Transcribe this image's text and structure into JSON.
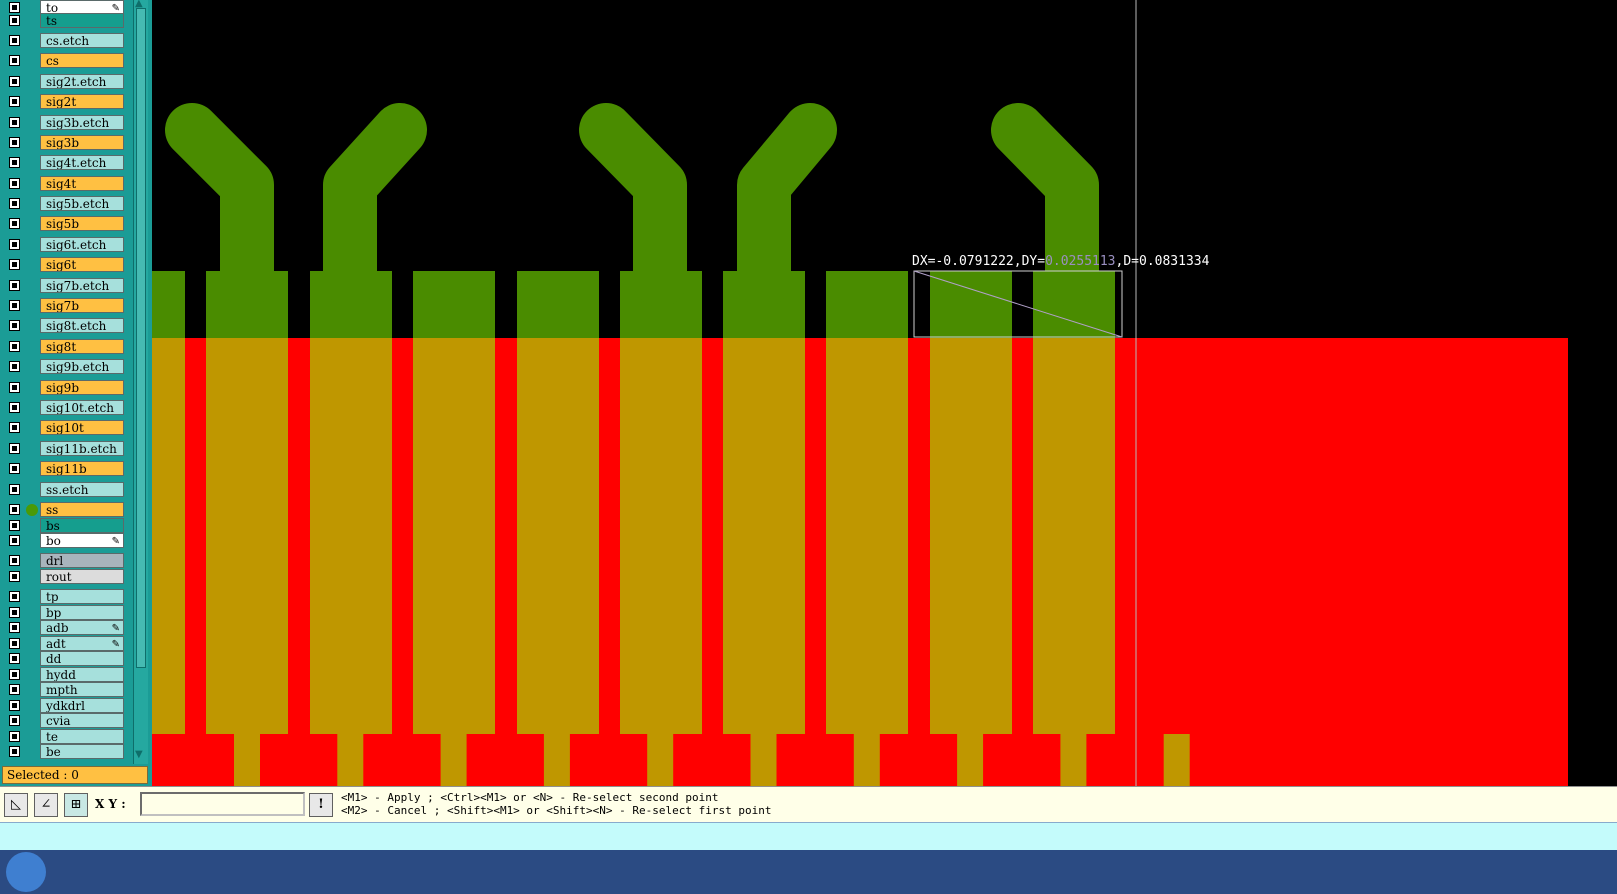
{
  "layers": [
    {
      "name": "to",
      "style": "white",
      "editable": true
    },
    {
      "name": "ts",
      "style": "teal"
    },
    {
      "name": "cs.etch",
      "style": "cyan"
    },
    {
      "name": "cs",
      "style": "orange"
    },
    {
      "name": "sig2t.etch",
      "style": "cyan"
    },
    {
      "name": "sig2t",
      "style": "orange"
    },
    {
      "name": "sig3b.etch",
      "style": "cyan"
    },
    {
      "name": "sig3b",
      "style": "orange"
    },
    {
      "name": "sig4t.etch",
      "style": "cyan"
    },
    {
      "name": "sig4t",
      "style": "orange"
    },
    {
      "name": "sig5b.etch",
      "style": "cyan"
    },
    {
      "name": "sig5b",
      "style": "orange"
    },
    {
      "name": "sig6t.etch",
      "style": "cyan"
    },
    {
      "name": "sig6t",
      "style": "orange"
    },
    {
      "name": "sig7b.etch",
      "style": "cyan"
    },
    {
      "name": "sig7b",
      "style": "orange"
    },
    {
      "name": "sig8t.etch",
      "style": "cyan"
    },
    {
      "name": "sig8t",
      "style": "orange"
    },
    {
      "name": "sig9b.etch",
      "style": "cyan"
    },
    {
      "name": "sig9b",
      "style": "orange"
    },
    {
      "name": "sig10t.etch",
      "style": "cyan"
    },
    {
      "name": "sig10t",
      "style": "orange"
    },
    {
      "name": "sig11b.etch",
      "style": "cyan"
    },
    {
      "name": "sig11b",
      "style": "orange"
    },
    {
      "name": "ss.etch",
      "style": "cyan"
    },
    {
      "name": "ss",
      "style": "orange",
      "active": true
    },
    {
      "name": "bs",
      "style": "teal"
    },
    {
      "name": "bo",
      "style": "white",
      "editable": true
    },
    {
      "name": "drl",
      "style": "grey"
    },
    {
      "name": "rout",
      "style": "lgrey"
    },
    {
      "name": "tp",
      "style": "cyan"
    },
    {
      "name": "bp",
      "style": "cyan"
    },
    {
      "name": "adb",
      "style": "cyan",
      "editable": true
    },
    {
      "name": "adt",
      "style": "cyan",
      "editable": true
    },
    {
      "name": "dd",
      "style": "cyan"
    },
    {
      "name": "hydd",
      "style": "cyan"
    },
    {
      "name": "mpth",
      "style": "cyan"
    },
    {
      "name": "ydkdrl",
      "style": "cyan"
    },
    {
      "name": "cvia",
      "style": "cyan"
    },
    {
      "name": "te",
      "style": "cyan"
    },
    {
      "name": "be",
      "style": "cyan"
    }
  ],
  "selected_text": "Selected : 0",
  "measure": {
    "prefix": "DX=-0.0791222,DY=",
    "dy": "0.0255113",
    "rest": ",D=0.0831334"
  },
  "toolbar": {
    "xy_label": "X Y :",
    "xy_value": "",
    "hint_line1": "<M1> - Apply  ; <Ctrl><M1> or <N> - Re-select second point",
    "hint_line2": "<M2> - Cancel ; <Shift><M1> or <Shift><N> - Re-select first point"
  },
  "colors": {
    "copper_top": "#4a8c00",
    "mask": "#ff0000",
    "overlap": "#bf9700",
    "panel": "#1b9c96"
  }
}
